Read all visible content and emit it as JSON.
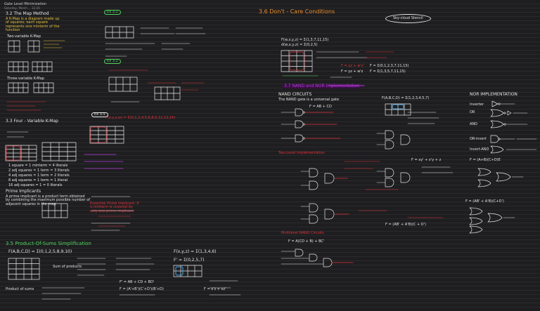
{
  "header": {
    "title": "Gate Level Minimization",
    "subtitle": "Saturday, March ... 12:26"
  },
  "headings": {
    "h32": "3.2 The Map Method",
    "h33": "3.3 Four - Variable K-Map",
    "h35": "3.5 Product-Of-Sums Simplification",
    "h36": "3.6 Don't - Care Conditions",
    "h37": "3.7 NAND and NOR Implementation",
    "nand": "NAND CIRCUITS",
    "nor": "NOR IMPLEMENTATION",
    "twolevel": "Two-Level Implementation",
    "multilevel": "Multilevel NAND Circuits",
    "prime": "Prime Implicants",
    "twovar": "Two-variable K-Map",
    "threevar": "Three-variable K-Map"
  },
  "badges": {
    "ex1": "Ex 3.1",
    "ex2": "Ex 3.2",
    "ex3": "Ex 3.5",
    "cloud": "Sky-cloud Stencil"
  },
  "notes": {
    "map_method": "A K-Map is a diagram made up of squares; each square represents one minterm of the function",
    "four_var_1": "F(x,y,z,w) = Σ(0,1,2,4,5,6,8,9,12,13,14)",
    "four_var_2": "1 square = 1 minterm = 4 literals",
    "four_var_3": "2 adj squares = 1 term = 3 literals",
    "four_var_4": "4 adj squares = 1 term = 2 literals",
    "four_var_5": "8 adj squares = 1 term = 1 literal",
    "four_var_6": "16 adj squares = 1 = 0 literals",
    "prime_def": "A prime implicant is a product term obtained by combining the maximum possible number of adjacent squares in the map",
    "prime_ess": "Essential Prime implicant: If a minterm is covered by only one prime implicant",
    "pos_1": "F(A,B,C,D) = Σ(0,1,2,5,8,9,10)",
    "pos_2": "Sum of products",
    "pos_3": "Product of sums",
    "pos_4": "F' = AB + CD + BD'",
    "pos_5": "F = (A'+B')(C'+D')(B'+D)",
    "pos_6": "F(x,y,z) = Σ(1,3,4,6)",
    "pos_7": "F' = Σ(0,2,5,7)",
    "pos_8": "F = x'z + xz'",
    "dc_1": "F(w,x,y,z) = Σ(1,3,7,11,15)",
    "dc_2": "d(w,x,y,z) = Σ(0,2,5)",
    "dc_3": "F = yz + w'x'",
    "dc_4": "F = yz + w'z",
    "dc_5": "F = Σ(0,1,2,3,7,11,15)",
    "dc_6": "F = Σ(1,3,5,7,11,15)",
    "nand_1": "The NAND gate is a universal gate",
    "nand_2": "F(A,B,C,D) = Σ(1,2,3,4,5,7)",
    "nand_3": "F = AB + CD",
    "nand_4": "F = xy' + x'y + z",
    "nand_5": "F = A(CD + B) + BC'",
    "nand_6": "F = (AB' + A'B)(C + D')",
    "nor_1": "Inverter",
    "nor_2": "OR",
    "nor_3": "AND",
    "nor_4": "OR-invert",
    "nor_5": "Invert-AND",
    "nor_6": "F = (A+B)(C+D)E",
    "nor_7": "F = (AB' + A'B)(C+D')"
  }
}
